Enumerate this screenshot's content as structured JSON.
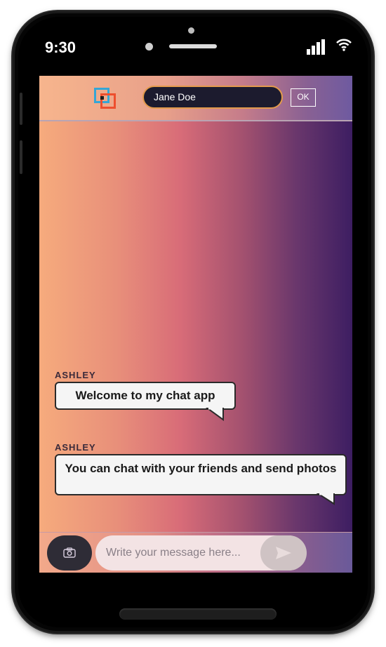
{
  "status_bar": {
    "time": "9:30"
  },
  "header": {
    "name_value": "Jane Doe",
    "ok_label": "OK"
  },
  "messages": [
    {
      "sender": "ASHLEY",
      "text": "Welcome to my chat app"
    },
    {
      "sender": "ASHLEY",
      "text": "You can chat with your friends and send photos"
    }
  ],
  "composer": {
    "placeholder": "Write your message here..."
  },
  "icons": {
    "logo": "overlapping-squares-logo",
    "camera": "camera-icon",
    "send": "send-icon",
    "signal": "signal-icon",
    "wifi": "wifi-icon"
  },
  "colors": {
    "gradient_start": "#f6ab7d",
    "gradient_mid": "#d86c78",
    "gradient_end": "#3d1e62",
    "input_bg": "#1c1b2e",
    "input_border": "#e39a4c"
  }
}
